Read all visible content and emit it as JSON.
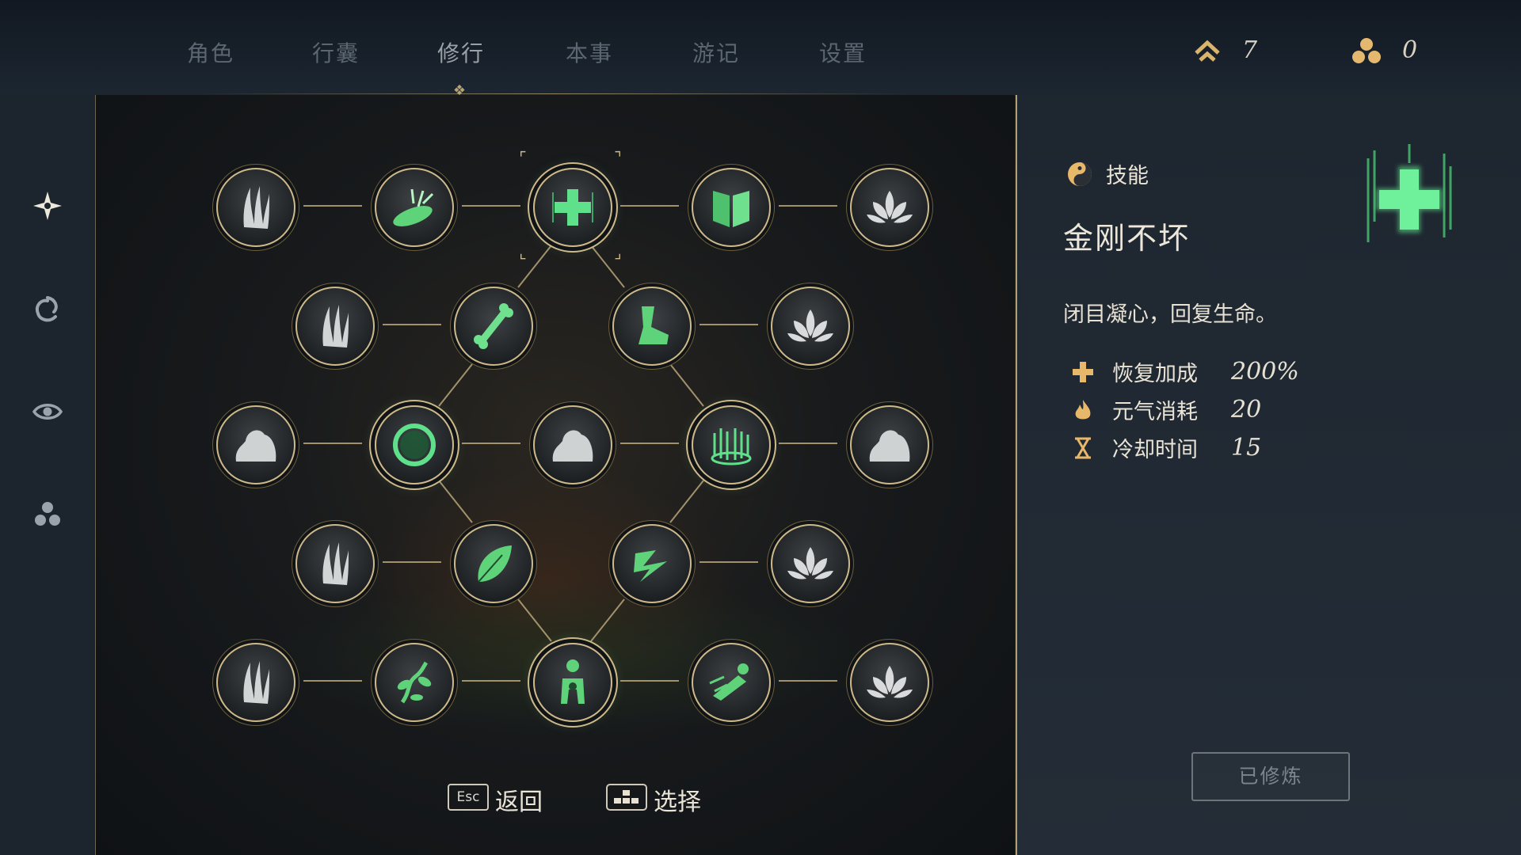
{
  "tabs": [
    {
      "label": "角色",
      "active": false
    },
    {
      "label": "行囊",
      "active": false
    },
    {
      "label": "修行",
      "active": true
    },
    {
      "label": "本事",
      "active": false
    },
    {
      "label": "游记",
      "active": false
    },
    {
      "label": "设置",
      "active": false
    }
  ],
  "currencies": {
    "level_points": {
      "icon": "double-chevron-up-icon",
      "value": "7"
    },
    "orbs": {
      "icon": "three-orbs-icon",
      "value": "0"
    }
  },
  "sidebar": {
    "items": [
      {
        "icon": "sparkle-icon",
        "active": true
      },
      {
        "icon": "swirl-icon",
        "active": false
      },
      {
        "icon": "eye-icon",
        "active": false
      },
      {
        "icon": "three-orbs-icon",
        "active": false
      }
    ]
  },
  "skill_tree": {
    "rows": [
      [
        "claw-icon",
        "slash-leaf-icon",
        "green-cross-icon",
        "book-icon",
        "lotus-icon"
      ],
      [
        "claw-icon",
        "bone-icon",
        "boot-icon",
        "lotus-icon"
      ],
      [
        "stone-icon",
        "green-ring-icon",
        "stone-icon",
        "green-pillar-icon",
        "stone-icon"
      ],
      [
        "claw-icon",
        "leaf-icon",
        "lightning-icon",
        "lotus-icon"
      ],
      [
        "claw-icon",
        "vine-icon",
        "figure-icon",
        "dash-icon",
        "lotus-icon"
      ]
    ],
    "selected": "green-cross-icon",
    "accent_color": "#4fd97a",
    "frame_color": "#cdb98a"
  },
  "hints": {
    "back_key": "Esc",
    "back_label": "返回",
    "select_label": "选择"
  },
  "detail": {
    "category_icon": "yin-yang-icon",
    "category": "技能",
    "title": "金刚不坏",
    "description": "闭目凝心，回复生命。",
    "stats": [
      {
        "icon": "plus-icon",
        "name": "恢复加成",
        "value": "200%"
      },
      {
        "icon": "flame-icon",
        "name": "元气消耗",
        "value": "20"
      },
      {
        "icon": "hourglass-icon",
        "name": "冷却时间",
        "value": "15"
      }
    ],
    "button_label": "已修炼"
  }
}
